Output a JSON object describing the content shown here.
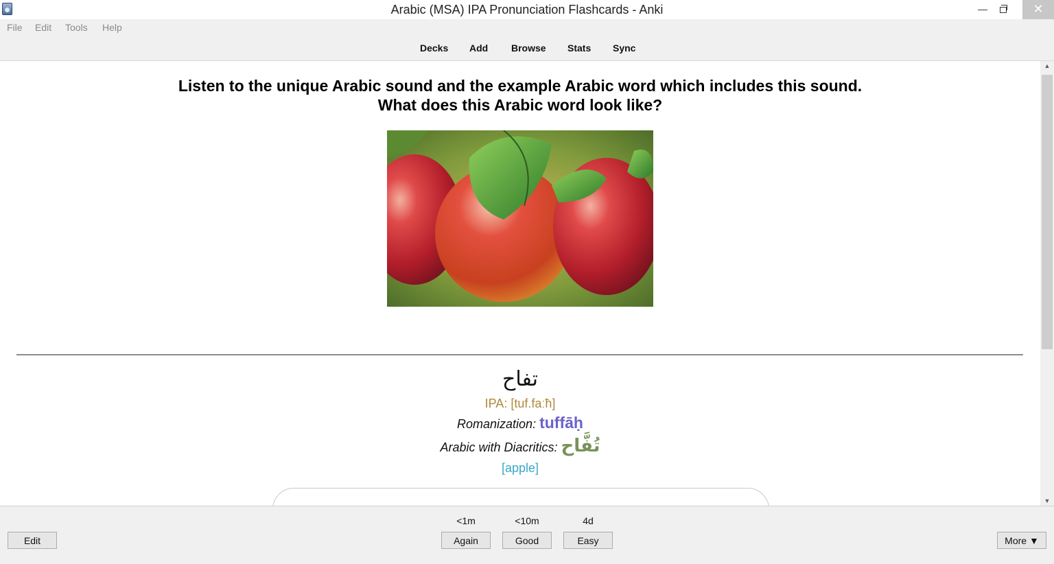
{
  "window": {
    "title": "Arabic (MSA) IPA Pronunciation Flashcards - Anki",
    "minimize_glyph": "—",
    "close_glyph": "✕"
  },
  "menu": {
    "items": [
      "File",
      "Edit",
      "Tools",
      "Help"
    ]
  },
  "toolbar": {
    "links": [
      "Decks",
      "Add",
      "Browse",
      "Stats",
      "Sync"
    ]
  },
  "card": {
    "question_line1": "Listen to the unique Arabic sound and the example Arabic word which includes this sound.",
    "question_line2": "What does this Arabic word look like?",
    "image_subject": "apples on a tree",
    "arabic_word": "تفاح",
    "ipa": "IPA: [tuf.faːħ]",
    "romanization_label": "Romanization:",
    "romanization_value": "tuffāḥ",
    "diacritics_label": "Arabic with Diacritics:",
    "diacritics_value": "تُفَّاح",
    "meaning": "[apple]"
  },
  "scrollbar": {
    "up_glyph": "▲",
    "down_glyph": "▼"
  },
  "bottom": {
    "edit_label": "Edit",
    "answers": [
      {
        "interval": "<1m",
        "label": "Again"
      },
      {
        "interval": "<10m",
        "label": "Good"
      },
      {
        "interval": "4d",
        "label": "Easy"
      }
    ],
    "more_label": "More ▼"
  },
  "colors": {
    "ipa": "#b0893a",
    "romanization": "#6a62c9",
    "diacritics": "#78925a",
    "meaning": "#3aa7c9"
  },
  "icons": [
    "anki-app-icon",
    "minimize-icon",
    "maximize-icon",
    "close-icon",
    "scroll-up-icon",
    "scroll-down-icon"
  ]
}
